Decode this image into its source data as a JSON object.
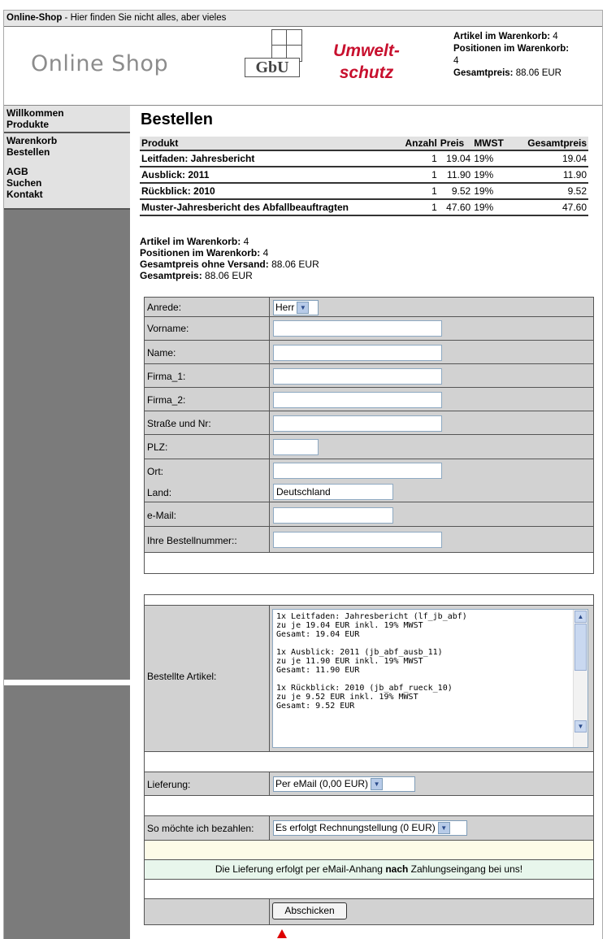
{
  "topbar": {
    "site": "Online-Shop",
    "tagline": " - Hier finden Sie nicht alles, aber vieles"
  },
  "header": {
    "logo_text": "Online Shop",
    "gbu": "GbU",
    "umwelt_line1": "Umwelt-",
    "umwelt_line2": "schutz",
    "cart_items_label": "Artikel im Warenkorb:",
    "cart_items_value": "4",
    "cart_positions_label": "Positionen im Warenkorb:",
    "cart_positions_value": "4",
    "cart_total_label": "Gesamtpreis:",
    "cart_total_value": "88.06 EUR"
  },
  "nav": {
    "groups": [
      [
        "Willkommen",
        "Produkte"
      ],
      [
        "Warenkorb",
        "Bestellen"
      ],
      [
        "AGB",
        "Suchen",
        "Kontakt"
      ]
    ]
  },
  "page_title": "Bestellen",
  "products": {
    "headers": [
      "Produkt",
      "Anzahl",
      "Preis",
      "MWST",
      "Gesamtpreis"
    ],
    "rows": [
      [
        "Leitfaden: Jahresbericht",
        "1",
        "19.04",
        "19%",
        "19.04"
      ],
      [
        "Ausblick: 2011",
        "1",
        "11.90",
        "19%",
        "11.90"
      ],
      [
        "Rückblick: 2010",
        "1",
        "9.52",
        "19%",
        "9.52"
      ],
      [
        "Muster-Jahresbericht des Abfallbeauftragten",
        "1",
        "47.60",
        "19%",
        "47.60"
      ]
    ]
  },
  "summary": {
    "items_label": "Artikel im Warenkorb:",
    "items_value": " 4",
    "positions_label": "Positionen im Warenkorb:",
    "positions_value": " 4",
    "nosend_label": "Gesamtpreis ohne Versand:",
    "nosend_value": " 88.06 EUR",
    "total_label": "Gesamtpreis:",
    "total_value": " 88.06 EUR"
  },
  "form": {
    "anrede_label": "Anrede:",
    "anrede_value": "Herr",
    "vorname_label": "Vorname:",
    "vorname_value": "",
    "name_label": "Name:",
    "name_value": "",
    "firma1_label": "Firma_1:",
    "firma1_value": "",
    "firma2_label": "Firma_2:",
    "firma2_value": "",
    "strasse_label": "Straße und Nr:",
    "strasse_value": "",
    "plz_label": "PLZ:",
    "plz_value": "",
    "ort_label": "Ort:",
    "ort_value": "",
    "land_label": "Land:",
    "land_value": "Deutschland",
    "email_label": "e-Mail:",
    "email_value": "",
    "bestellnr_label": "Ihre Bestellnummer::",
    "bestellnr_value": "",
    "artikel_label": "Bestellte Artikel:",
    "artikel_text": "1x Leitfaden: Jahresbericht (lf_jb_abf)\nzu je 19.04 EUR inkl. 19% MWST\nGesamt: 19.04 EUR\n\n1x Ausblick: 2011 (jb_abf_ausb_11)\nzu je 11.90 EUR inkl. 19% MWST\nGesamt: 11.90 EUR\n\n1x Rückblick: 2010 (jb_abf_rueck_10)\nzu je 9.52 EUR inkl. 19% MWST\nGesamt: 9.52 EUR",
    "lieferung_label": "Lieferung:",
    "lieferung_value": "Per eMail (0,00 EUR)",
    "bezahlen_label": "So möchte ich bezahlen:",
    "bezahlen_value": "Es erfolgt Rechnungstellung (0 EUR)",
    "notice_pre": "Die Lieferung erfolgt per eMail-Anhang ",
    "notice_bold": "nach",
    "notice_post": " Zahlungseingang bei uns!",
    "submit_label": "Abschicken"
  }
}
